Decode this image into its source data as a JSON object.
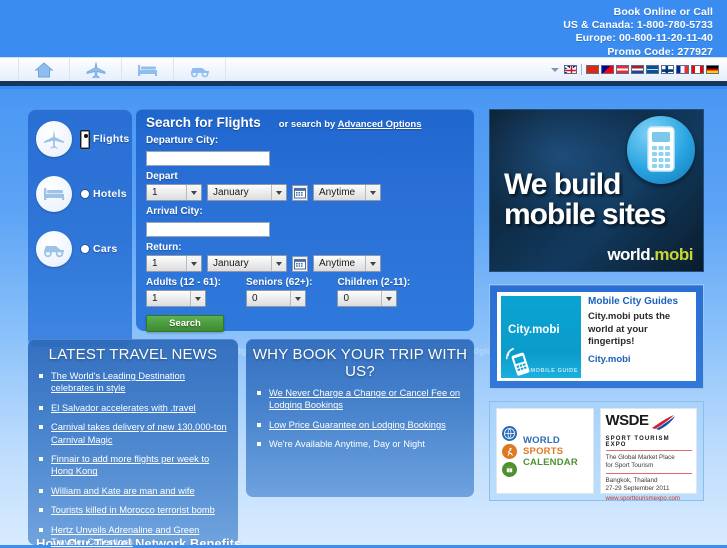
{
  "header": {
    "contact": [
      "Book Online or Call",
      "US & Canada: 1-800-780-5733",
      "Europe: 00-800-11-20-11-40",
      "Promo Code: 277927"
    ]
  },
  "nav": {
    "items": [
      {
        "name": "home",
        "icon": "home-icon"
      },
      {
        "name": "flights",
        "icon": "plane-icon"
      },
      {
        "name": "hotels",
        "icon": "bed-icon"
      },
      {
        "name": "cars",
        "icon": "car-icon"
      }
    ],
    "languages": [
      {
        "name": "english",
        "colors": [
          "#00247d",
          "#ffffff",
          "#cf142b"
        ]
      },
      {
        "name": "china",
        "colors": [
          "#de2910",
          "#ffde00",
          "#de2910"
        ]
      },
      {
        "name": "taiwan",
        "colors": [
          "#fe0000",
          "#000095",
          "#ffffff"
        ]
      },
      {
        "name": "austria",
        "colors": [
          "#ed2939",
          "#ffffff",
          "#ed2939"
        ]
      },
      {
        "name": "netherlands",
        "colors": [
          "#ae1c28",
          "#ffffff",
          "#21468b"
        ]
      },
      {
        "name": "iceland",
        "colors": [
          "#02529c",
          "#ffffff",
          "#dc1e35"
        ]
      },
      {
        "name": "finland",
        "colors": [
          "#ffffff",
          "#003580",
          "#ffffff"
        ]
      },
      {
        "name": "france",
        "colors": [
          "#002395",
          "#ffffff",
          "#ed2939"
        ]
      },
      {
        "name": "canada",
        "colors": [
          "#ff0000",
          "#ffffff",
          "#ff0000"
        ]
      },
      {
        "name": "germany",
        "colors": [
          "#000000",
          "#dd0000",
          "#ffce00"
        ]
      }
    ]
  },
  "picker": {
    "items": [
      {
        "label": "Flights",
        "icon": "plane-icon",
        "selected": true
      },
      {
        "label": "Hotels",
        "icon": "bed-icon",
        "selected": false
      },
      {
        "label": "Cars",
        "icon": "car-icon",
        "selected": false
      }
    ]
  },
  "search": {
    "title": "Search for Flights",
    "alt_prefix": "or search by",
    "alt_link": "Advanced Options",
    "departure_label": "Departure City:",
    "departure_value": "",
    "departure_placeholder": "",
    "depart_label": "Depart",
    "depart_day": "1",
    "depart_month": "January",
    "depart_time": "Anytime",
    "arrival_label": "Arrival City:",
    "arrival_value": "",
    "arrival_placeholder": "",
    "return_label": "Return:",
    "return_day": "1",
    "return_month": "January",
    "return_time": "Anytime",
    "adults_label": "Adults (12 - 61):",
    "adults_value": "1",
    "seniors_label": "Seniors (62+):",
    "seniors_value": "0",
    "children_label": "Children (2-11):",
    "children_value": "0",
    "submit_label": "Search"
  },
  "ad_main": {
    "line1": "We build",
    "line2": "mobile sites",
    "brand_white": "world.",
    "brand_green": "mobi"
  },
  "guides": {
    "logo_text": "City.mobi",
    "logo_sub": "MOBILE GUIDE",
    "title": "Mobile City Guides",
    "body": "City.mobi puts the world at your fingertips!",
    "link": "City.mobi"
  },
  "sponsors": {
    "calendar": {
      "w1": "WORLD",
      "w2": "SPORTS",
      "w3": "CALENDAR"
    },
    "expo": {
      "name": "WSDE",
      "sub": "SPORT TOURISM EXPO",
      "tagline1": "The Global Market Place",
      "tagline2": "for Sport Tourism",
      "location": "Bangkok, Thailand",
      "dates": "27-29 September 2011",
      "url": "www.sporttourismexpo.com"
    }
  },
  "news": {
    "title": "LATEST TRAVEL NEWS",
    "items": [
      "The World's Leading Destination celebrates in style",
      "El Salvador accelerates with .travel",
      "Carnival takes delivery of new 130,000-ton Carnival Magic",
      "Finnair to add more flights per week to Hong Kong",
      "William and Kate are man and wife",
      "Tourists killed in Morocco terrorist bomb",
      "Hertz Unveils Adrenaline and Green Traveler Collections"
    ],
    "cut_heading": "How Our Travel Network Benefits Travellers"
  },
  "why": {
    "title": "WHY BOOK YOUR TRIP WITH US?",
    "items": [
      {
        "text": "We Never Charge a Change or Cancel Fee on Lodging Bookings",
        "link": true
      },
      {
        "text": "Low Price Guarantee on Lodging Bookings",
        "link": true
      },
      {
        "text": "We're Available Anytime, Day or Night",
        "link": false
      }
    ]
  },
  "ghost": {
    "left": "nce on lodging bookings",
    "service": "service",
    "right": "odging bookings     Anytime"
  },
  "colors": {
    "page_blue": "#3b8cf0",
    "panel_blue": "#2a6fd4",
    "form_blue": "#1f66cf",
    "search_green": "#4c9c40",
    "link_white": "#ffffff",
    "nav_underline": "#17365d"
  }
}
